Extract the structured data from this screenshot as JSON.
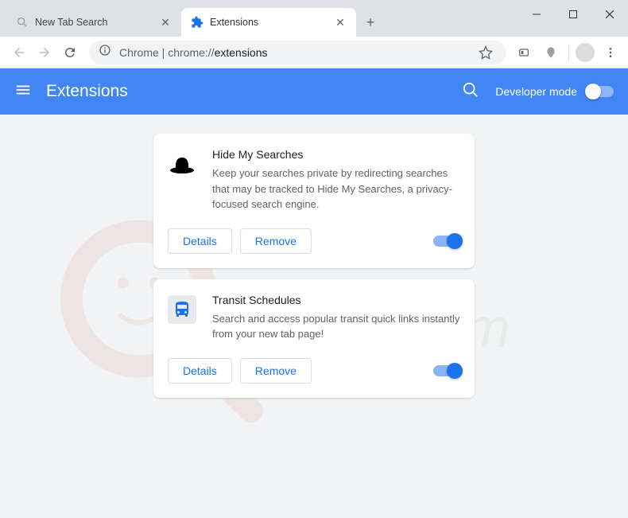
{
  "window": {
    "minimize": "–",
    "maximize": "▢",
    "close": "✕"
  },
  "tabs": [
    {
      "title": "New Tab Search",
      "active": false
    },
    {
      "title": "Extensions",
      "active": true
    }
  ],
  "omnibox": {
    "prefix": "Chrome",
    "sep": " | ",
    "url_gray": "chrome://",
    "url_dark": "extensions"
  },
  "ext_header": {
    "title": "Extensions",
    "dev_mode": "Developer mode"
  },
  "extensions": [
    {
      "name": "Hide My Searches",
      "description": "Keep your searches private by redirecting searches that may be tracked to Hide My Searches, a privacy-focused search engine.",
      "icon": "hat"
    },
    {
      "name": "Transit Schedules",
      "description": "Search and access popular transit quick links instantly from your new tab page!",
      "icon": "bus"
    }
  ],
  "buttons": {
    "details": "Details",
    "remove": "Remove"
  },
  "watermark": "pcrisk.com"
}
